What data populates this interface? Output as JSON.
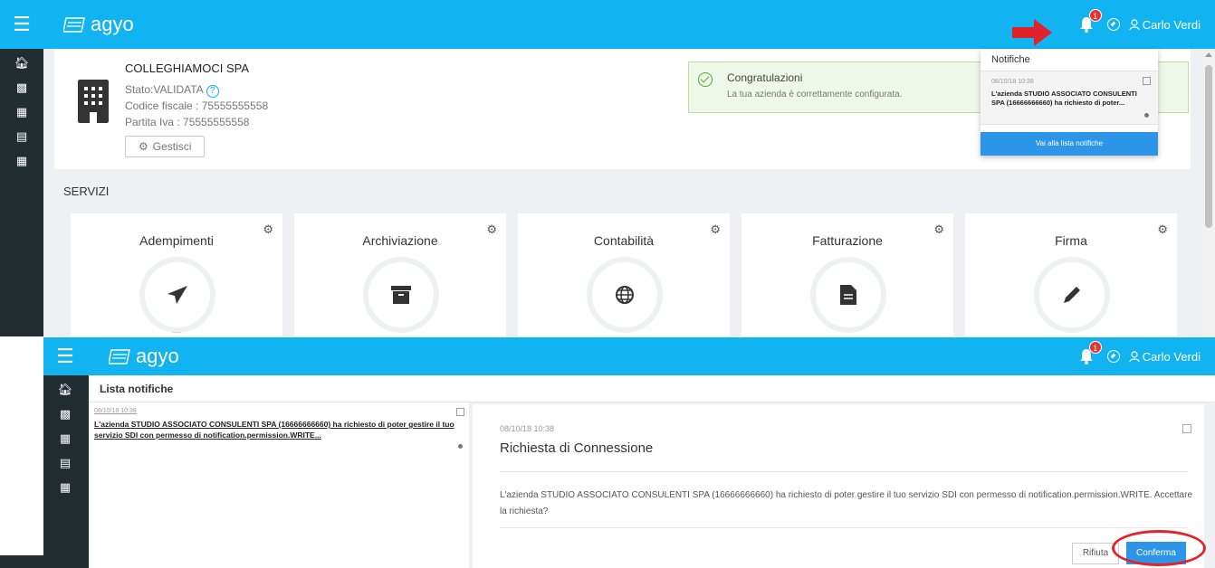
{
  "colors": {
    "header_blue": "#12b3f1",
    "sidebar_dark": "#222d32",
    "primary_button": "#2d95e8",
    "annotation_red": "#e0242a",
    "success_green": "#59a630"
  },
  "header": {
    "logo_text": "agyo",
    "notification_count": "1",
    "user_name": "Carlo Verdi"
  },
  "sidebar": {
    "icons": [
      "home-icon",
      "briefcase-icon",
      "building-icon",
      "id-card-icon",
      "grid-icon"
    ]
  },
  "company": {
    "name": "COLLEGHIAMOCI SPA",
    "status": "Stato:VALIDATA",
    "fiscal_code": "Codice fiscale : 75555555558",
    "vat": "Partita Iva : 75555555558",
    "manage_label": "Gestisci"
  },
  "alert": {
    "title": "Congratulazioni",
    "text": "La tua azienda è correttamente configurata."
  },
  "services": {
    "title": "SERVIZI",
    "items": [
      {
        "name": "Adempimenti",
        "icon": "paper-plane-icon"
      },
      {
        "name": "Archiviazione",
        "icon": "archive-icon"
      },
      {
        "name": "Contabilità",
        "icon": "globe-icon"
      },
      {
        "name": "Fatturazione",
        "icon": "file-icon"
      },
      {
        "name": "Firma",
        "icon": "pencil-icon"
      }
    ]
  },
  "dropdown": {
    "title": "Notifiche",
    "item_date": "08/10/18 10:38",
    "item_text": "L'azienda STUDIO ASSOCIATO CONSULENTI SPA (16666666660) ha richiesto di poter...",
    "button": "Vai alla lista notifiche"
  },
  "notifications": {
    "title": "Lista notifiche",
    "item_date": "08/10/18 10:38",
    "item_text": "L'azienda STUDIO ASSOCIATO CONSULENTI SPA (16666666660) ha richiesto di poter gestire il tuo servizio SDI con permesso di notification.permission.WRITE..."
  },
  "detail": {
    "date": "08/10/18 10:38",
    "title": "Richiesta di Connessione",
    "text": "L'azienda STUDIO ASSOCIATO CONSULENTI SPA (16666666660) ha richiesto di poter gestire il tuo servizio SDI con permesso di notification.permission.WRITE. Accettare la richiesta?",
    "reject_label": "Rifiuta",
    "confirm_label": "Conferma"
  }
}
